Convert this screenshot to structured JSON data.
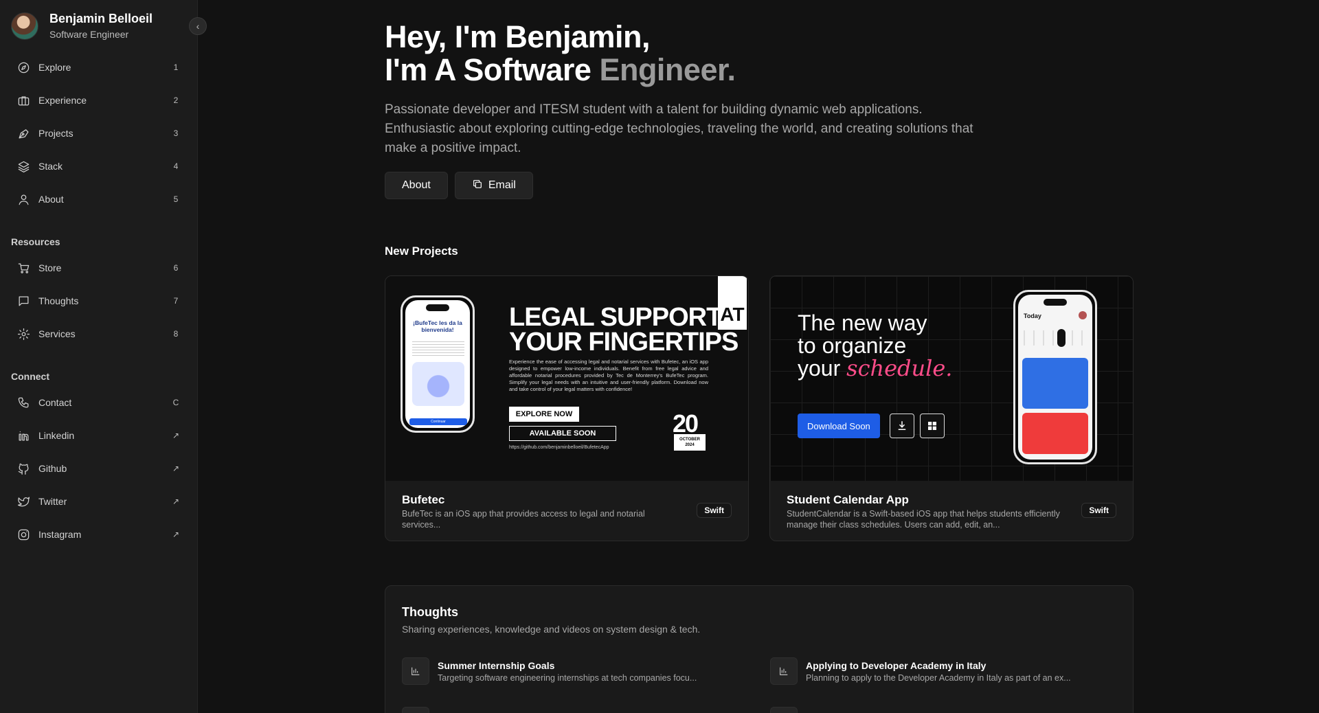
{
  "profile": {
    "name": "Benjamin Belloeil",
    "role": "Software Engineer"
  },
  "sidebar": {
    "primary": [
      {
        "label": "Explore",
        "key": "1",
        "icon": "compass-icon"
      },
      {
        "label": "Experience",
        "key": "2",
        "icon": "briefcase-icon"
      },
      {
        "label": "Projects",
        "key": "3",
        "icon": "pen-tool-icon"
      },
      {
        "label": "Stack",
        "key": "4",
        "icon": "layers-icon"
      },
      {
        "label": "About",
        "key": "5",
        "icon": "user-icon"
      }
    ],
    "resources_title": "Resources",
    "resources": [
      {
        "label": "Store",
        "key": "6",
        "icon": "cart-icon"
      },
      {
        "label": "Thoughts",
        "key": "7",
        "icon": "message-square-icon"
      },
      {
        "label": "Services",
        "key": "8",
        "icon": "gear-icon"
      }
    ],
    "connect_title": "Connect",
    "connect": [
      {
        "label": "Contact",
        "key": "C",
        "icon": "phone-icon"
      },
      {
        "label": "Linkedin",
        "key": "↗",
        "icon": "linkedin-icon"
      },
      {
        "label": "Github",
        "key": "↗",
        "icon": "github-icon"
      },
      {
        "label": "Twitter",
        "key": "↗",
        "icon": "twitter-icon"
      },
      {
        "label": "Instagram",
        "key": "↗",
        "icon": "instagram-icon"
      }
    ]
  },
  "hero": {
    "line1": "Hey, I'm Benjamin,",
    "line2_a": "I'm A Software",
    "line2_b": "Engineer.",
    "description": "Passionate developer and ITESM student with a talent for building dynamic web applications. Enthusiastic about exploring cutting-edge technologies, traveling the world, and creating solutions that make a positive impact.",
    "about_label": "About",
    "email_label": "Email"
  },
  "projects": {
    "title": "New Projects",
    "items": [
      {
        "title": "Bufetec",
        "description": "BufeTec is an iOS app that provides access to legal and notarial services...",
        "tag": "Swift",
        "promo": {
          "headline_1": "LEGAL SUPPORT",
          "headline_at": "AT",
          "headline_2": "YOUR FINGERTIPS",
          "body": "Experience the ease of accessing legal and notarial services with Bufetec, an iOS app designed to empower low-income individuals. Benefit from free legal advice and affordable notarial procedures provided by Tec de Monterrey's BufeTec program. Simplify your legal needs with an intuitive and user-friendly platform. Download now and take control of your legal matters with confidence!",
          "explore": "EXPLORE NOW",
          "available": "AVAILABLE SOON",
          "link": "https://github.com/benjaminbelloeil/BufetecApp",
          "date_day": "20",
          "date_month": "OCTOBER",
          "date_year": "2024",
          "screen_title": "¡BufeTec les da la bienvenida!",
          "screen_button": "Continuar"
        }
      },
      {
        "title": "Student Calendar App",
        "description": "StudentCalendar is a Swift-based iOS app that helps students efficiently manage their class schedules. Users can add, edit, an...",
        "tag": "Swift",
        "promo": {
          "headline_1": "The new way",
          "headline_2": "to organize",
          "headline_3": "your",
          "headline_script": "schedule.",
          "download": "Download Soon",
          "screen_title": "Today"
        }
      }
    ]
  },
  "thoughts": {
    "title": "Thoughts",
    "subtitle": "Sharing experiences, knowledge and videos on system design & tech.",
    "items": [
      {
        "title": "Summer Internship Goals",
        "description": "Targeting software engineering internships at tech companies focu..."
      },
      {
        "title": "Applying to Developer Academy in Italy",
        "description": "Planning to apply to the Developer Academy in Italy as part of an ex..."
      },
      {
        "title": "",
        "description": ""
      },
      {
        "title": "",
        "description": ""
      }
    ]
  },
  "colors": {
    "background": "#121212",
    "sidebar": "#1c1c1c",
    "accent_blue": "#1e5de6",
    "accent_pink": "#ff4d8a",
    "muted_heading": "#9a9a9a"
  }
}
